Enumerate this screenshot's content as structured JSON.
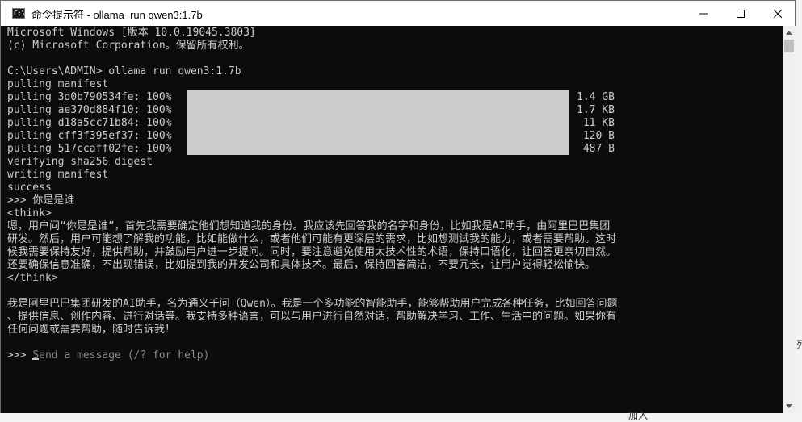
{
  "window": {
    "title": "命令提示符 - ollama  run qwen3:1.7b",
    "icon_label": "C:\\",
    "min_icon": "minimize-icon",
    "max_icon": "maximize-icon",
    "close_icon": "close-icon"
  },
  "terminal": {
    "header_lines": [
      "Microsoft Windows [版本 10.0.19045.3803]",
      "(c) Microsoft Corporation。保留所有权利。",
      "",
      "C:\\Users\\ADMIN> ollama run qwen3:1.7b",
      "pulling manifest"
    ],
    "pulls": [
      {
        "name": "pulling 3d0b790534fe: 100%",
        "size": "1.4 GB"
      },
      {
        "name": "pulling ae370d884f10: 100%",
        "size": "1.7 KB"
      },
      {
        "name": "pulling d18a5cc71b84: 100%",
        "size": "11 KB"
      },
      {
        "name": "pulling cff3f395ef37: 100%",
        "size": "120 B"
      },
      {
        "name": "pulling 517ccaff02fe: 100%",
        "size": "487 B"
      }
    ],
    "pull_progress": 1.0,
    "after_lines": [
      "verifying sha256 digest",
      "writing manifest",
      "success",
      ">>> 你是是谁",
      "<think>",
      "嗯，用户问“你是是谁”，首先我需要确定他们想知道我的身份。我应该先回答我的名字和身份，比如我是AI助手，由阿里巴巴集团",
      "研发。然后，用户可能想了解我的功能，比如能做什么，或者他们可能有更深层的需求，比如想测试我的能力，或者需要帮助。这时",
      "候我需要保持友好，提供帮助，并鼓励用户进一步提问。同时，要注意避免使用太技术性的术语，保持口语化，让回答更亲切自然。",
      "还要确保信息准确，不出现错误，比如提到我的开发公司和具体技术。最后，保持回答简洁，不要冗长，让用户觉得轻松愉快。",
      "</think>",
      "",
      "我是阿里巴巴集团研发的AI助手，名为通义千问（Qwen）。我是一个多功能的智能助手，能够帮助用户完成各种任务，比如回答问题",
      "、提供信息、创作内容、进行对话等。我支持多种语言，可以与用户进行自然对话，帮助解决学习、工作、生活中的问题。如果你有",
      "任何问题或需要帮助，随时告诉我！",
      ""
    ],
    "prompt": ">>> ",
    "input_placeholder": "Send a message (/? for help)"
  },
  "background": {
    "fragment_1": "列",
    "fragment_2": "加入"
  },
  "colors": {
    "terminal_bg": "#0c0c0c",
    "terminal_text": "#cccccc",
    "progress_fill": "#cccccc",
    "titlebar_bg": "#ffffff"
  }
}
